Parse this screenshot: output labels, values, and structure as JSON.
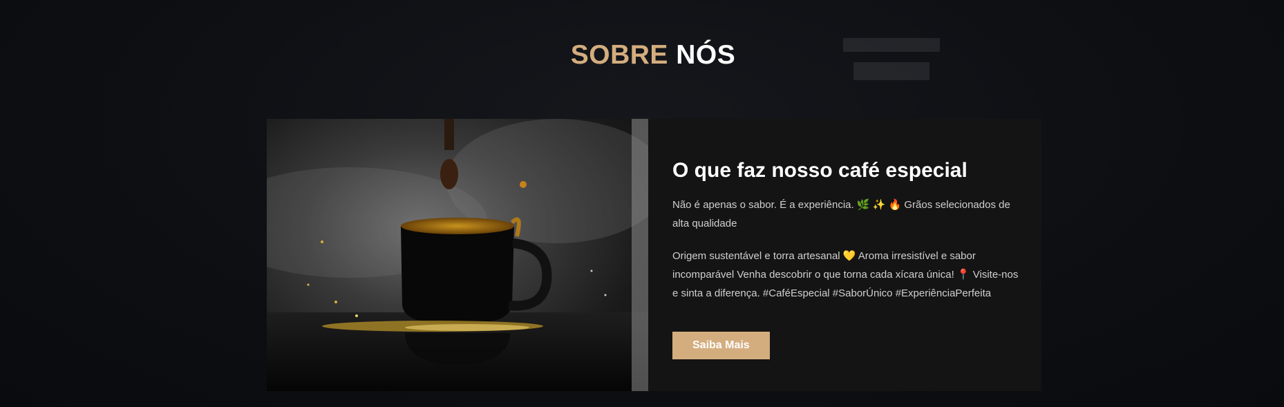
{
  "section": {
    "title_accent": "SOBRE",
    "title_main": "NÓS"
  },
  "about_card": {
    "image_alt": "Xícara de café preto com respingos",
    "heading": "O que faz nosso café especial",
    "paragraph_1": "Não é apenas o sabor. É a experiência. 🌿 ✨ 🔥 Grãos selecionados de alta qualidade",
    "paragraph_2": "Origem sustentável e torra artesanal 💛 Aroma irresistível e sabor incomparável Venha descobrir o que torna cada xícara única! 📍 Visite-nos e sinta a diferença. #CaféEspecial #SaborÚnico #ExperiênciaPerfeita",
    "button_label": "Saiba Mais"
  },
  "colors": {
    "accent": "#d4ad7e",
    "background": "#0d0f13",
    "card_background": "#141414"
  }
}
